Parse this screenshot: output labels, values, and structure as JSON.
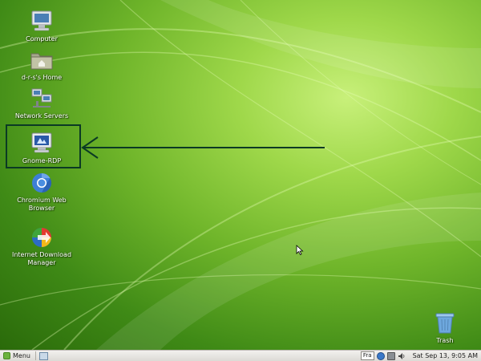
{
  "desktop": {
    "icons": [
      {
        "label": "Computer",
        "icon": "computer-icon"
      },
      {
        "label": "d-r-s's Home",
        "icon": "home-folder-icon"
      },
      {
        "label": "Network Servers",
        "icon": "network-servers-icon"
      },
      {
        "label": "Gnome-RDP",
        "icon": "gnome-rdp-icon"
      },
      {
        "label": "Chromium Web Browser",
        "icon": "chromium-icon"
      },
      {
        "label": "Internet Download Manager",
        "icon": "download-manager-icon"
      }
    ],
    "trash_label": "Trash",
    "annotation_color": "#0b3a24"
  },
  "panel": {
    "menu_label": "Menu",
    "keyboard_layout": "Fra",
    "clock": "Sat Sep 13,  9:05 AM"
  },
  "colors": {
    "wallpaper_accent": "#9fd84a",
    "panel_bg": "#e8e6e1"
  }
}
